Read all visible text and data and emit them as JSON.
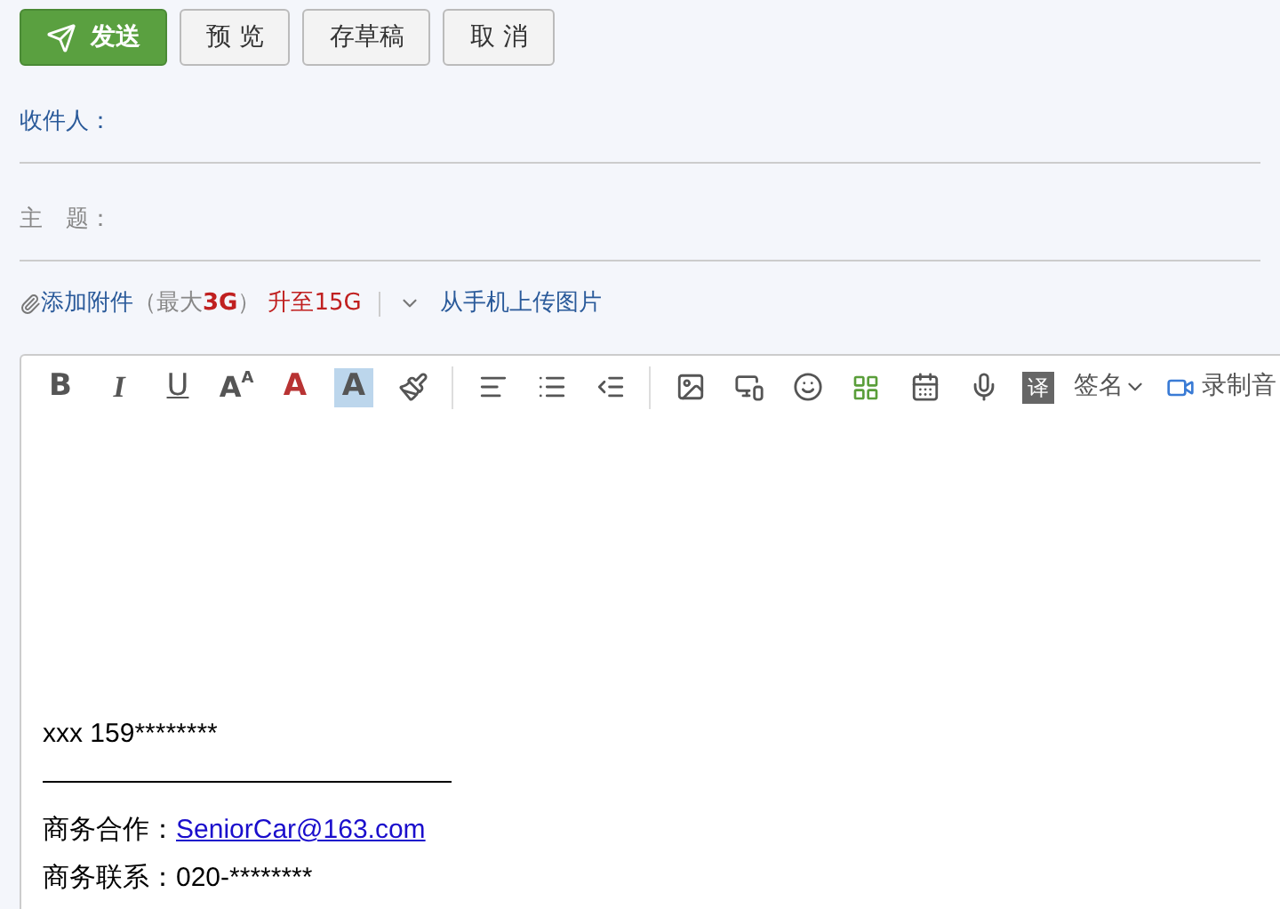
{
  "actions": [
    {
      "label": "发送",
      "kind": "primary"
    },
    {
      "label": "预 览",
      "kind": "normal"
    },
    {
      "label": "存草稿",
      "kind": "normal"
    },
    {
      "label": "取 消",
      "kind": "normal"
    }
  ],
  "recipient": {
    "label": "收件人："
  },
  "subject": {
    "label": "主　题："
  },
  "attachment": {
    "add": "添加附件",
    "limit_open": "（最大",
    "limit_size": "3G",
    "limit_close": "）",
    "upgrade": "升至15G",
    "phone_upload": "从手机上传图片"
  },
  "toolbar": [
    {
      "kind": "bold",
      "text": "B"
    },
    {
      "kind": "italic",
      "text": "I"
    },
    {
      "kind": "underline",
      "text": "U"
    },
    {
      "kind": "size",
      "text": "A",
      "sup": "A"
    },
    {
      "kind": "color",
      "text": "A"
    },
    {
      "kind": "bg",
      "text": "A"
    },
    {
      "kind": "brush"
    },
    {
      "kind": "sep"
    },
    {
      "kind": "align"
    },
    {
      "kind": "list"
    },
    {
      "kind": "indent"
    },
    {
      "kind": "sep"
    },
    {
      "kind": "image"
    },
    {
      "kind": "screenshot"
    },
    {
      "kind": "emoji"
    },
    {
      "kind": "template"
    },
    {
      "kind": "calendar"
    },
    {
      "kind": "mic"
    },
    {
      "kind": "translate",
      "text": "译"
    },
    {
      "kind": "menu",
      "text": "签名"
    },
    {
      "kind": "video",
      "text": "录制音"
    }
  ],
  "body": {
    "lines": [
      {
        "kind": "plain",
        "text": "xxx 159********"
      },
      {
        "kind": "rule"
      },
      {
        "kind": "labeled",
        "label": "商务合作：",
        "link": "SeniorCar@163.com"
      },
      {
        "kind": "labeled",
        "label": "商务联系：",
        "value": "020-********"
      }
    ]
  }
}
